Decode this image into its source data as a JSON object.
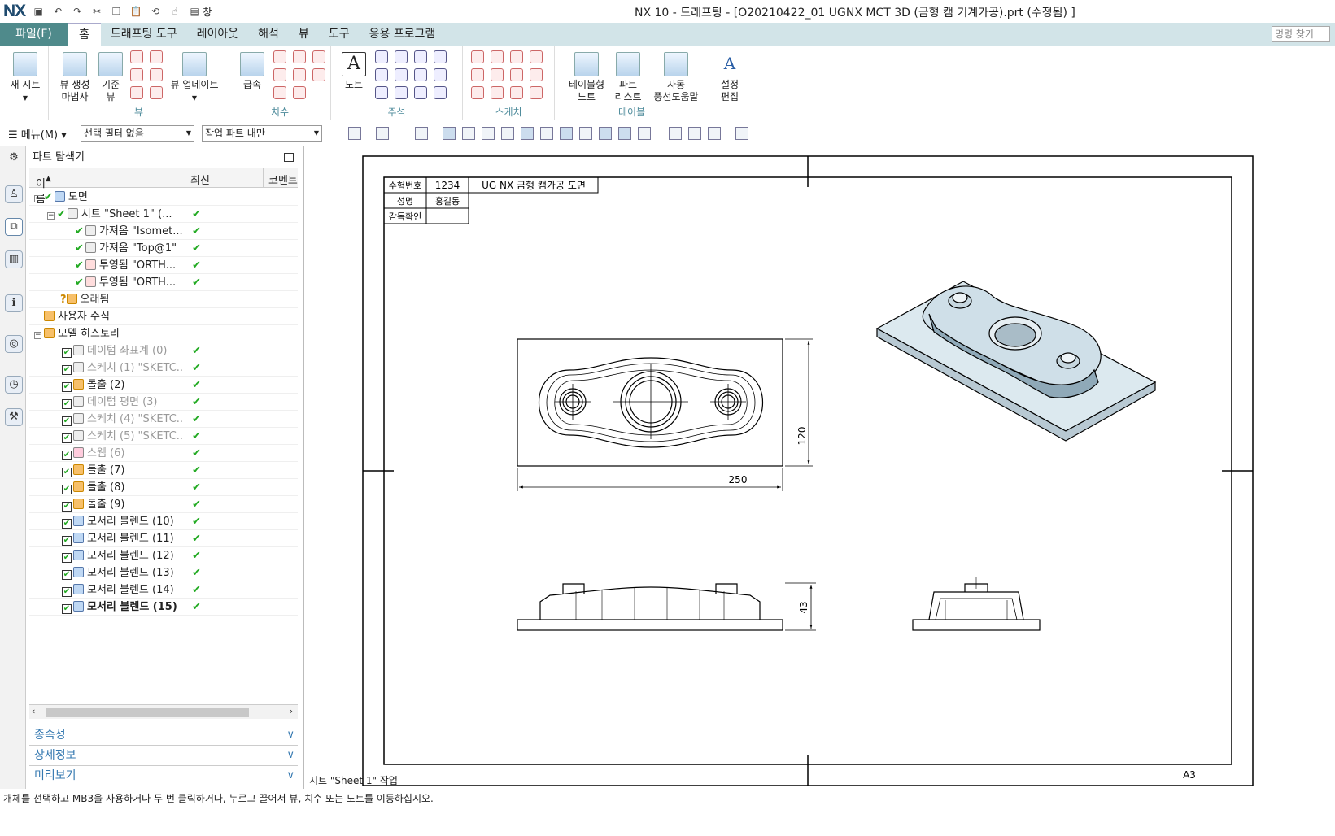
{
  "titlebar": {
    "logo": "NX",
    "window_label": "창",
    "title": "NX 10 - 드래프팅 - [O20210422_01 UGNX MCT 3D (금형 캠 기계가공).prt (수정됨) ]"
  },
  "tabs": {
    "file": "파일(F)",
    "home": "홈",
    "drafting_tools": "드래프팅 도구",
    "layout": "레이아웃",
    "analysis": "해석",
    "view": "뷰",
    "tools": "도구",
    "applications": "응용 프로그램",
    "command_search_placeholder": "명령 찾기"
  },
  "ribbon": {
    "new_sheet": "새 시트",
    "view_wizard_1": "뷰 생성",
    "view_wizard_2": "마법사",
    "base_view_1": "기준",
    "base_view_2": "뷰",
    "update_views": "뷰 업데이트",
    "group_view": "뷰",
    "rapid": "급속",
    "group_dimension": "치수",
    "note": "노트",
    "group_annotation": "주석",
    "group_sketch": "스케치",
    "tabular_note_1": "테이블형",
    "tabular_note_2": "노트",
    "parts_list_1": "파트",
    "parts_list_2": "리스트",
    "auto_balloon_1": "자동",
    "auto_balloon_2": "풍선도움말",
    "group_table": "테이블",
    "edit_settings_1": "설정",
    "edit_settings_2": "편집"
  },
  "toolbar2": {
    "menu": "메뉴(M)",
    "selection_filter": "선택 필터 없음",
    "scope": "작업 파트 내만"
  },
  "navigator": {
    "title": "파트 탐색기",
    "col_name": "이름",
    "col_latest": "최신",
    "col_comment": "코멘트",
    "rows": [
      {
        "label": "도면",
        "latest": ""
      },
      {
        "label": "시트 \"Sheet 1\" (...",
        "latest": "✔"
      },
      {
        "label": "가져옴 \"Isomet...",
        "latest": "✔"
      },
      {
        "label": "가져옴 \"Top@1\"",
        "latest": "✔"
      },
      {
        "label": "투영됨 \"ORTH...",
        "latest": "✔"
      },
      {
        "label": "투영됨 \"ORTH...",
        "latest": "✔"
      },
      {
        "label": "오래됨",
        "latest": ""
      },
      {
        "label": "사용자 수식",
        "latest": ""
      },
      {
        "label": "모델 히스토리",
        "latest": ""
      },
      {
        "label": "데이텀 좌표계 (0)",
        "latest": "✔"
      },
      {
        "label": "스케치 (1) \"SKETC...",
        "latest": "✔"
      },
      {
        "label": "돌출 (2)",
        "latest": "✔"
      },
      {
        "label": "데이텀 평면 (3)",
        "latest": "✔"
      },
      {
        "label": "스케치 (4) \"SKETC...",
        "latest": "✔"
      },
      {
        "label": "스케치 (5) \"SKETC...",
        "latest": "✔"
      },
      {
        "label": "스웹 (6)",
        "latest": "✔"
      },
      {
        "label": "돌출 (7)",
        "latest": "✔"
      },
      {
        "label": "돌출 (8)",
        "latest": "✔"
      },
      {
        "label": "돌출 (9)",
        "latest": "✔"
      },
      {
        "label": "모서리 블렌드 (10)",
        "latest": "✔"
      },
      {
        "label": "모서리 블렌드 (11)",
        "latest": "✔"
      },
      {
        "label": "모서리 블렌드 (12)",
        "latest": "✔"
      },
      {
        "label": "모서리 블렌드 (13)",
        "latest": "✔"
      },
      {
        "label": "모서리 블렌드 (14)",
        "latest": "✔"
      },
      {
        "label": "모서리 블렌드 (15)",
        "latest": "✔"
      }
    ],
    "panels": {
      "dependencies": "종속성",
      "details": "상세정보",
      "preview": "미리보기"
    }
  },
  "drawing": {
    "title_block": {
      "exam_no_label": "수험번호",
      "exam_no_value": "1234",
      "title": "UG NX 금형 캠가공 도면",
      "name_label": "성명",
      "name_value": "홍길동",
      "supervisor_label": "감독확인",
      "supervisor_value": ""
    },
    "dim_width": "250",
    "dim_height": "120",
    "dim_side_height": "43",
    "sheet_size": "A3"
  },
  "sheet_work_label": "시트 \"Sheet 1\" 작업",
  "status": "개체를 선택하고 MB3을 사용하거나 두 번 클릭하거나, 누르고 끌어서 뷰, 치수 또는 노트를 이동하십시오."
}
